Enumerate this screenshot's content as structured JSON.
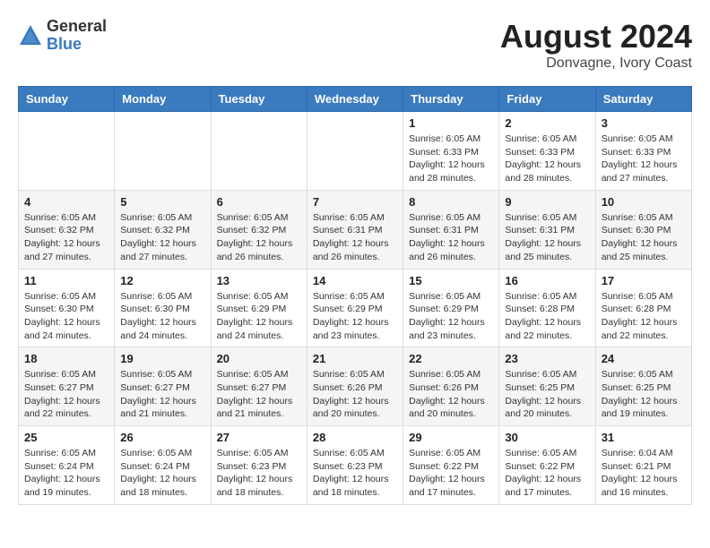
{
  "logo": {
    "general": "General",
    "blue": "Blue"
  },
  "header": {
    "month_year": "August 2024",
    "location": "Donvagne, Ivory Coast"
  },
  "weekdays": [
    "Sunday",
    "Monday",
    "Tuesday",
    "Wednesday",
    "Thursday",
    "Friday",
    "Saturday"
  ],
  "weeks": [
    [
      {
        "day": "",
        "info": ""
      },
      {
        "day": "",
        "info": ""
      },
      {
        "day": "",
        "info": ""
      },
      {
        "day": "",
        "info": ""
      },
      {
        "day": "1",
        "info": "Sunrise: 6:05 AM\nSunset: 6:33 PM\nDaylight: 12 hours\nand 28 minutes."
      },
      {
        "day": "2",
        "info": "Sunrise: 6:05 AM\nSunset: 6:33 PM\nDaylight: 12 hours\nand 28 minutes."
      },
      {
        "day": "3",
        "info": "Sunrise: 6:05 AM\nSunset: 6:33 PM\nDaylight: 12 hours\nand 27 minutes."
      }
    ],
    [
      {
        "day": "4",
        "info": "Sunrise: 6:05 AM\nSunset: 6:32 PM\nDaylight: 12 hours\nand 27 minutes."
      },
      {
        "day": "5",
        "info": "Sunrise: 6:05 AM\nSunset: 6:32 PM\nDaylight: 12 hours\nand 27 minutes."
      },
      {
        "day": "6",
        "info": "Sunrise: 6:05 AM\nSunset: 6:32 PM\nDaylight: 12 hours\nand 26 minutes."
      },
      {
        "day": "7",
        "info": "Sunrise: 6:05 AM\nSunset: 6:31 PM\nDaylight: 12 hours\nand 26 minutes."
      },
      {
        "day": "8",
        "info": "Sunrise: 6:05 AM\nSunset: 6:31 PM\nDaylight: 12 hours\nand 26 minutes."
      },
      {
        "day": "9",
        "info": "Sunrise: 6:05 AM\nSunset: 6:31 PM\nDaylight: 12 hours\nand 25 minutes."
      },
      {
        "day": "10",
        "info": "Sunrise: 6:05 AM\nSunset: 6:30 PM\nDaylight: 12 hours\nand 25 minutes."
      }
    ],
    [
      {
        "day": "11",
        "info": "Sunrise: 6:05 AM\nSunset: 6:30 PM\nDaylight: 12 hours\nand 24 minutes."
      },
      {
        "day": "12",
        "info": "Sunrise: 6:05 AM\nSunset: 6:30 PM\nDaylight: 12 hours\nand 24 minutes."
      },
      {
        "day": "13",
        "info": "Sunrise: 6:05 AM\nSunset: 6:29 PM\nDaylight: 12 hours\nand 24 minutes."
      },
      {
        "day": "14",
        "info": "Sunrise: 6:05 AM\nSunset: 6:29 PM\nDaylight: 12 hours\nand 23 minutes."
      },
      {
        "day": "15",
        "info": "Sunrise: 6:05 AM\nSunset: 6:29 PM\nDaylight: 12 hours\nand 23 minutes."
      },
      {
        "day": "16",
        "info": "Sunrise: 6:05 AM\nSunset: 6:28 PM\nDaylight: 12 hours\nand 22 minutes."
      },
      {
        "day": "17",
        "info": "Sunrise: 6:05 AM\nSunset: 6:28 PM\nDaylight: 12 hours\nand 22 minutes."
      }
    ],
    [
      {
        "day": "18",
        "info": "Sunrise: 6:05 AM\nSunset: 6:27 PM\nDaylight: 12 hours\nand 22 minutes."
      },
      {
        "day": "19",
        "info": "Sunrise: 6:05 AM\nSunset: 6:27 PM\nDaylight: 12 hours\nand 21 minutes."
      },
      {
        "day": "20",
        "info": "Sunrise: 6:05 AM\nSunset: 6:27 PM\nDaylight: 12 hours\nand 21 minutes."
      },
      {
        "day": "21",
        "info": "Sunrise: 6:05 AM\nSunset: 6:26 PM\nDaylight: 12 hours\nand 20 minutes."
      },
      {
        "day": "22",
        "info": "Sunrise: 6:05 AM\nSunset: 6:26 PM\nDaylight: 12 hours\nand 20 minutes."
      },
      {
        "day": "23",
        "info": "Sunrise: 6:05 AM\nSunset: 6:25 PM\nDaylight: 12 hours\nand 20 minutes."
      },
      {
        "day": "24",
        "info": "Sunrise: 6:05 AM\nSunset: 6:25 PM\nDaylight: 12 hours\nand 19 minutes."
      }
    ],
    [
      {
        "day": "25",
        "info": "Sunrise: 6:05 AM\nSunset: 6:24 PM\nDaylight: 12 hours\nand 19 minutes."
      },
      {
        "day": "26",
        "info": "Sunrise: 6:05 AM\nSunset: 6:24 PM\nDaylight: 12 hours\nand 18 minutes."
      },
      {
        "day": "27",
        "info": "Sunrise: 6:05 AM\nSunset: 6:23 PM\nDaylight: 12 hours\nand 18 minutes."
      },
      {
        "day": "28",
        "info": "Sunrise: 6:05 AM\nSunset: 6:23 PM\nDaylight: 12 hours\nand 18 minutes."
      },
      {
        "day": "29",
        "info": "Sunrise: 6:05 AM\nSunset: 6:22 PM\nDaylight: 12 hours\nand 17 minutes."
      },
      {
        "day": "30",
        "info": "Sunrise: 6:05 AM\nSunset: 6:22 PM\nDaylight: 12 hours\nand 17 minutes."
      },
      {
        "day": "31",
        "info": "Sunrise: 6:04 AM\nSunset: 6:21 PM\nDaylight: 12 hours\nand 16 minutes."
      }
    ]
  ]
}
